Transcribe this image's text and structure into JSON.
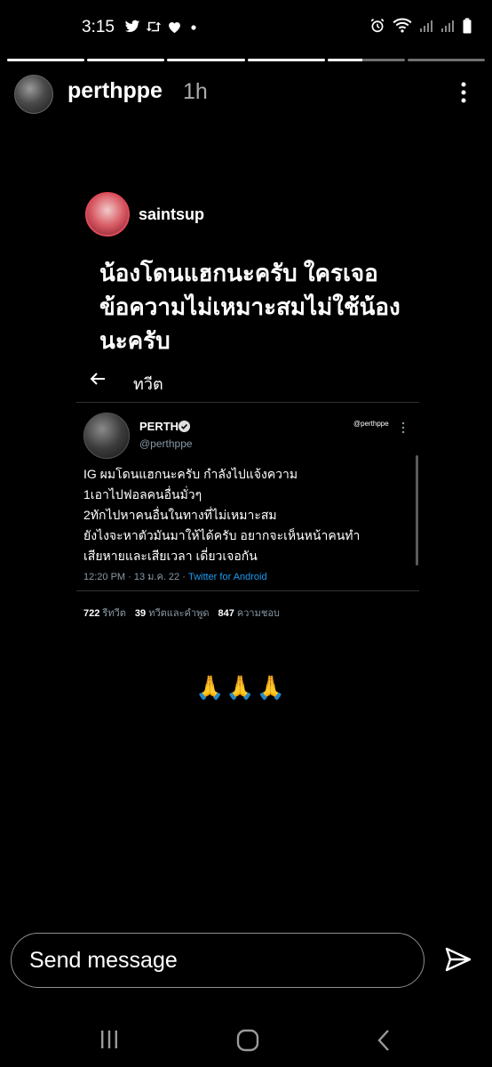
{
  "status_bar": {
    "time": "3:15",
    "left_icons": [
      "twitter-icon",
      "retweet-icon",
      "heart-icon",
      "dot-icon"
    ],
    "right_icons": [
      "alarm-icon",
      "wifi-icon",
      "signal-icon",
      "signal-icon",
      "battery-icon"
    ]
  },
  "story": {
    "segments_total": 6,
    "segments_seen": 4,
    "current_segment": 5,
    "username": "perthppe",
    "time_ago": "1h"
  },
  "repost": {
    "username": "saintsup",
    "caption": "น้องโดนแฮกนะครับ ใครเจอ\nข้อความไม่เหมาะสมไม่ใช้น้อง\nนะครับ",
    "tweet_screen": {
      "header_title": "ทวีต",
      "author_name": "PERTH",
      "author_handle": "@perthppe",
      "corner_handle": "@perthppe",
      "body": "IG ผมโดนแฮกนะครับ กำลังไปแจ้งความ\n1เอาไปฟอลคนอื่นมั่วๆ\n2ทักไปหาคนอื่นในทางที่ไม่เหมาะสม\nยังไงจะหาตัวมันมาให้ได้ครับ อยากจะเห็นหน้าคนทำ\nเสียหายและเสียเวลา เดี่ยวเจอกัน",
      "timestamp": "12:20 PM · 13 ม.ค. 22 · ",
      "source": "Twitter for Android",
      "stats": [
        {
          "count": "722",
          "label": "รีทวีต"
        },
        {
          "count": "39",
          "label": "ทวีตและคำพูด"
        },
        {
          "count": "847",
          "label": "ความชอบ"
        }
      ]
    },
    "emoji": "🙏🙏🙏"
  },
  "composer": {
    "placeholder": "Send message",
    "send_icon": "send-icon"
  },
  "nav": [
    "recents-icon",
    "home-icon",
    "back-icon"
  ]
}
